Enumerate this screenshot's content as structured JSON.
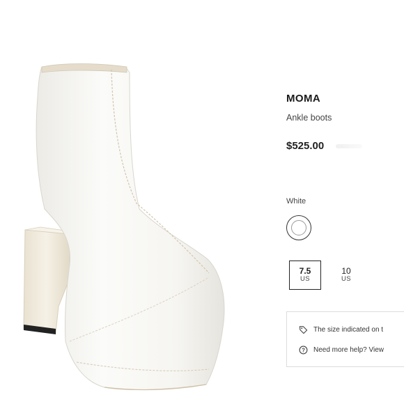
{
  "product": {
    "brand": "MOMA",
    "category": "Ankle boots",
    "price": "$525.00"
  },
  "color": {
    "label": "White",
    "swatch_color": "#ffffff"
  },
  "sizes": [
    {
      "value": "7.5",
      "unit": "US",
      "selected": true
    },
    {
      "value": "10",
      "unit": "US",
      "selected": false
    }
  ],
  "info": {
    "size_note": "The size indicated on t",
    "help": "Need more help? View"
  },
  "icons": {
    "size_note": "tag-icon",
    "help": "help-circle-icon"
  },
  "colors": {
    "boot": "#f8f7f4",
    "heel": "#f2ecdd",
    "text": "#1e1e1e"
  }
}
